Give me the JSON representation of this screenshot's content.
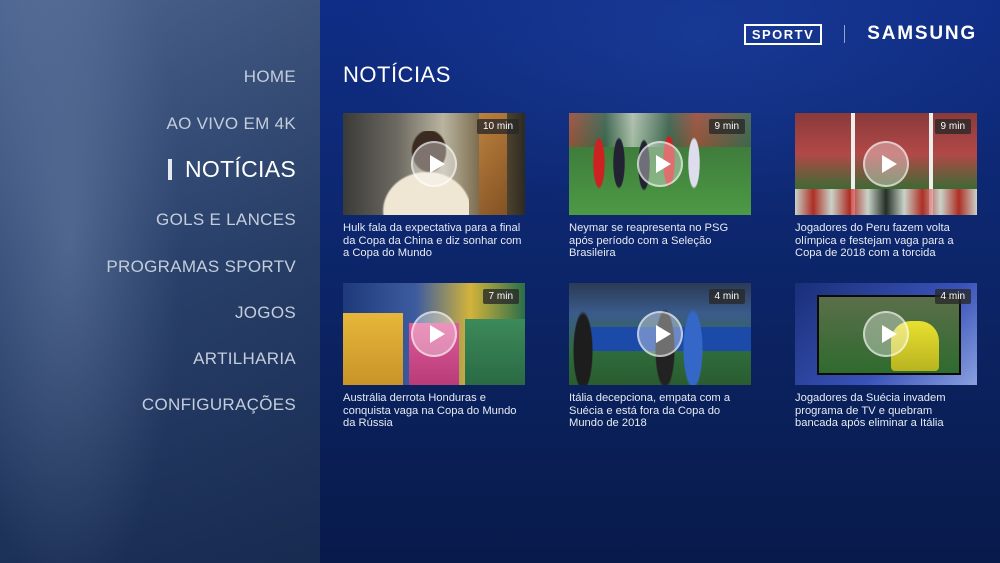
{
  "header": {
    "brand_sportv": "SPORTV",
    "brand_samsung": "SAMSUNG"
  },
  "sidebar": {
    "items": [
      {
        "label": "HOME",
        "active": false
      },
      {
        "label": "AO VIVO EM 4K",
        "active": false
      },
      {
        "label": "NOTÍCIAS",
        "active": true
      },
      {
        "label": "GOLS E LANCES",
        "active": false
      },
      {
        "label": "PROGRAMAS SPORTV",
        "active": false
      },
      {
        "label": "JOGOS",
        "active": false
      },
      {
        "label": "ARTILHARIA",
        "active": false
      },
      {
        "label": "CONFIGURAÇÕES",
        "active": false
      }
    ]
  },
  "main": {
    "title": "NOTÍCIAS",
    "videos": [
      {
        "duration": "10 min",
        "caption": "Hulk fala da expectativa para a final da Copa da China e diz sonhar com a Copa do Mundo"
      },
      {
        "duration": "9 min",
        "caption": "Neymar se reapresenta no PSG após período com a Seleção Brasileira"
      },
      {
        "duration": "9 min",
        "caption": "Jogadores do Peru fazem volta olímpica e festejam vaga para a Copa de 2018 com a torcida"
      },
      {
        "duration": "7 min",
        "caption": "Austrália derrota Honduras e conquista vaga na Copa do Mundo da Rússia"
      },
      {
        "duration": "4 min",
        "caption": "Itália decepciona, empata com a Suécia e está fora da Copa do Mundo de 2018"
      },
      {
        "duration": "4 min",
        "caption": "Jogadores da Suécia invadem programa de TV e quebram bancada após eliminar a Itália"
      }
    ]
  },
  "colors": {
    "background": "#0f2d86",
    "sidebar": "#3b5580",
    "active_indicator": "#e6e9ef"
  },
  "icons": {
    "play": "play-icon"
  }
}
